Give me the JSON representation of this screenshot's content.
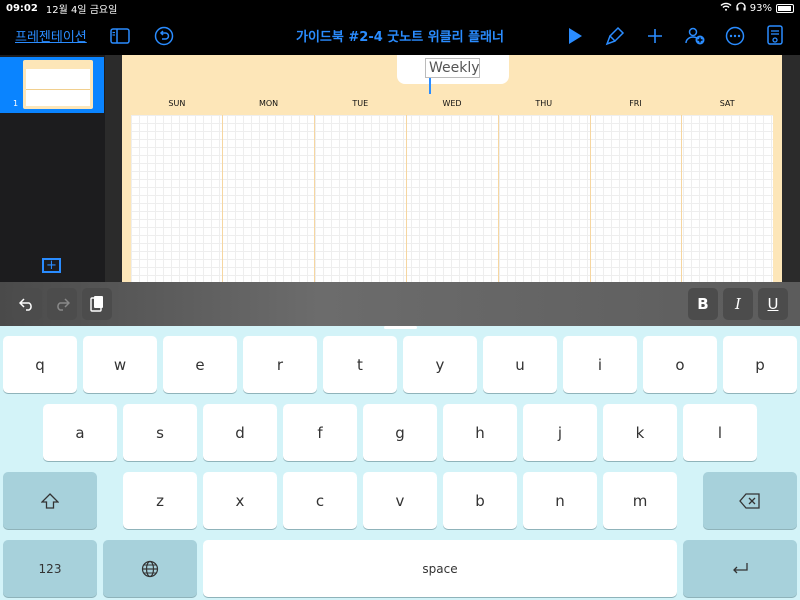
{
  "status": {
    "time": "09:02",
    "date": "12월 4일 금요일",
    "battery": "93%",
    "battery_level": 0.93
  },
  "toolbar": {
    "presentation_label": "프레젠테이션",
    "document_title": "가이드북 #2-4 굿노트 위클리 플래너"
  },
  "sidebar": {
    "slides": [
      {
        "number": "1"
      }
    ]
  },
  "slide": {
    "title_text": "Weekly",
    "days": [
      "SUN",
      "MON",
      "TUE",
      "WED",
      "THU",
      "FRI",
      "SAT"
    ]
  },
  "format_bar": {
    "bold_label": "B",
    "italic_label": "I",
    "underline_label": "U"
  },
  "keyboard": {
    "row1": [
      "q",
      "w",
      "e",
      "r",
      "t",
      "y",
      "u",
      "i",
      "o",
      "p"
    ],
    "row2": [
      "a",
      "s",
      "d",
      "f",
      "g",
      "h",
      "j",
      "k",
      "l"
    ],
    "row3": [
      "z",
      "x",
      "c",
      "v",
      "b",
      "n",
      "m"
    ],
    "numbers_label": "123",
    "space_label": "space"
  },
  "colors": {
    "accent": "#2a8cff",
    "slide_bg": "#fde6b8",
    "keyboard_bg": "#d3f3f8",
    "sidebar_selected": "#0a84ff"
  },
  "icons": [
    "wifi-icon",
    "headphones-icon",
    "battery-icon",
    "sidebar-toggle-icon",
    "undo-history-icon",
    "play-icon",
    "format-brush-icon",
    "add-icon",
    "collaborate-icon",
    "more-icon",
    "document-icon",
    "add-slide-icon",
    "undo-icon",
    "redo-icon",
    "paste-icon",
    "shift-icon",
    "delete-icon",
    "globe-icon",
    "return-icon"
  ]
}
